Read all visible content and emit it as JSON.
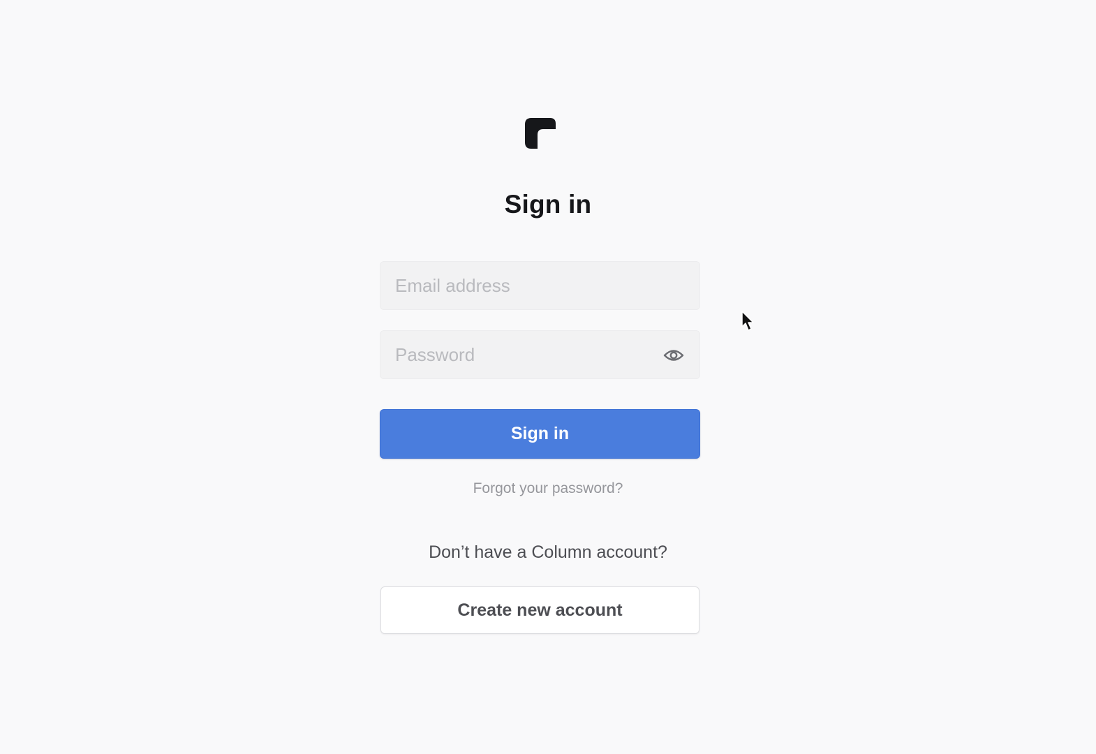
{
  "brand": {
    "logo_icon": "column-logo-icon",
    "logo_color": "#16171a"
  },
  "header": {
    "title": "Sign in"
  },
  "form": {
    "email": {
      "value": "",
      "placeholder": "Email address"
    },
    "password": {
      "value": "",
      "placeholder": "Password",
      "toggle_icon": "eye-icon"
    },
    "submit_label": "Sign in",
    "forgot_label": "Forgot your password?"
  },
  "signup": {
    "prompt": "Don’t have a Column account?",
    "button_label": "Create new account"
  },
  "colors": {
    "background": "#f9f9fa",
    "primary": "#4a7ddd",
    "text": "#16171a",
    "muted": "#96979c"
  }
}
